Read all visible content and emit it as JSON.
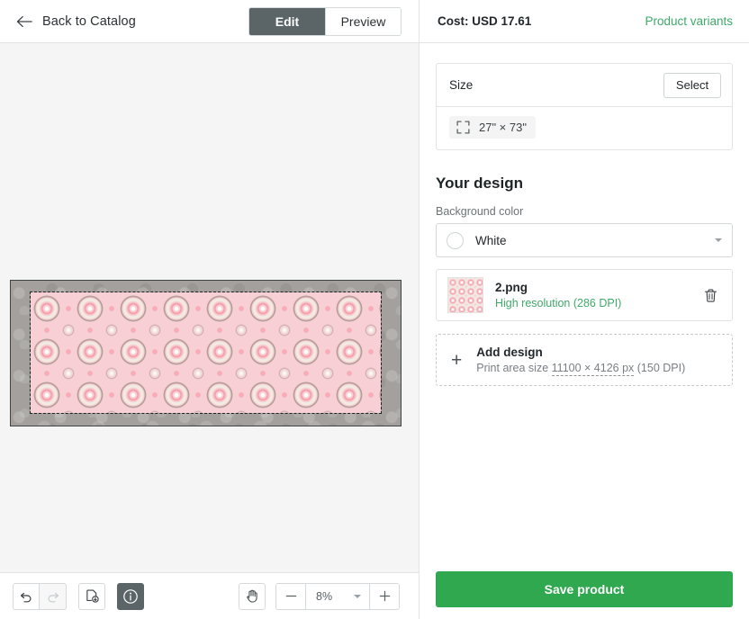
{
  "left_header": {
    "back_label": "Back to Catalog",
    "back_icon": "arrow-left-icon",
    "tabs": [
      {
        "label": "Edit",
        "active": true
      },
      {
        "label": "Preview",
        "active": false
      }
    ]
  },
  "right_header": {
    "cost_label": "Cost: USD 17.61",
    "variants_label": "Product variants",
    "variants_color": "#3fa96a"
  },
  "size_card": {
    "title": "Size",
    "select_label": "Select",
    "chip_icon": "expand-corners-icon",
    "chip_label": "27\" × 73\""
  },
  "design": {
    "section_title": "Your design",
    "background_color_label": "Background color",
    "background_color_value": "White",
    "background_swatch_hex": "#ffffff",
    "dropdown_icon": "chevron-down-icon",
    "file": {
      "name": "2.png",
      "status": "High resolution (286 DPI)",
      "status_color": "#3fa96a",
      "delete_icon": "trash-icon",
      "thumbnail_icon": "design-thumbnail"
    },
    "add_design": {
      "icon": "plus-icon",
      "title": "Add design",
      "subtitle_prefix": "Print area size ",
      "subtitle_value": "11100 × 4126 px",
      "subtitle_suffix": " (150 DPI)"
    }
  },
  "canvas": {
    "rug_pattern": "pink-floral-mandala",
    "print_area_outline": "dashed"
  },
  "toolbar": {
    "undo_icon": "undo-icon",
    "redo_icon": "redo-icon",
    "export_icon": "file-download-icon",
    "info_icon": "info-icon",
    "pan_icon": "hand-pan-icon",
    "zoom_out_icon": "minus-icon",
    "zoom_level": "8%",
    "zoom_caret_icon": "chevron-down-icon",
    "zoom_in_icon": "plus-icon"
  },
  "footer": {
    "save_label": "Save product",
    "save_color": "#2fa84f"
  }
}
